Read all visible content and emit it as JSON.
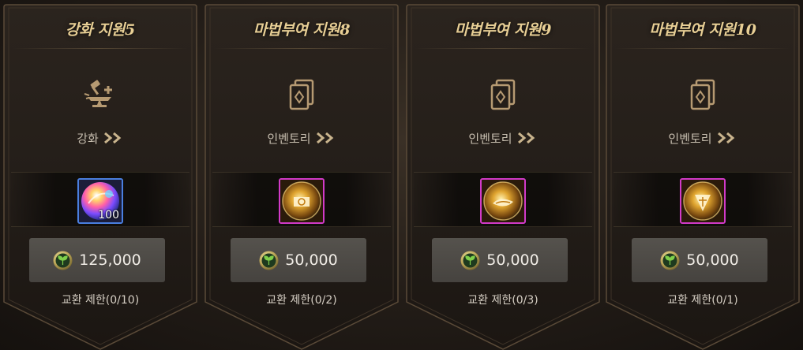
{
  "cards": [
    {
      "title": "강화 지원5",
      "category": "강화",
      "category_icon": "anvil-hammer-plus-icon",
      "item": {
        "icon": "rainbow-orb-icon",
        "quantity": "100",
        "border": "blue"
      },
      "price": "125,000",
      "limit": "교환 제한(0/10)"
    },
    {
      "title": "마법부여 지원8",
      "category": "인벤토리",
      "category_icon": "cards-icon",
      "item": {
        "icon": "golden-scroll-orb-icon",
        "quantity": "",
        "border": "purple"
      },
      "price": "50,000",
      "limit": "교환 제한(0/2)"
    },
    {
      "title": "마법부여 지원9",
      "category": "인벤토리",
      "category_icon": "cards-icon",
      "item": {
        "icon": "golden-scroll-orb-icon",
        "quantity": "",
        "border": "purple"
      },
      "price": "50,000",
      "limit": "교환 제한(0/3)"
    },
    {
      "title": "마법부여 지원10",
      "category": "인벤토리",
      "category_icon": "cards-icon",
      "item": {
        "icon": "golden-scroll-orb-icon",
        "quantity": "",
        "border": "purple"
      },
      "price": "50,000",
      "limit": "교환 제한(0/1)"
    }
  ],
  "currency_icon": "green-leaf-coin-icon",
  "colors": {
    "title_gold": "#e8cf95",
    "item_border_blue": "#4a7fe0",
    "item_border_purple": "#d23ac8"
  }
}
